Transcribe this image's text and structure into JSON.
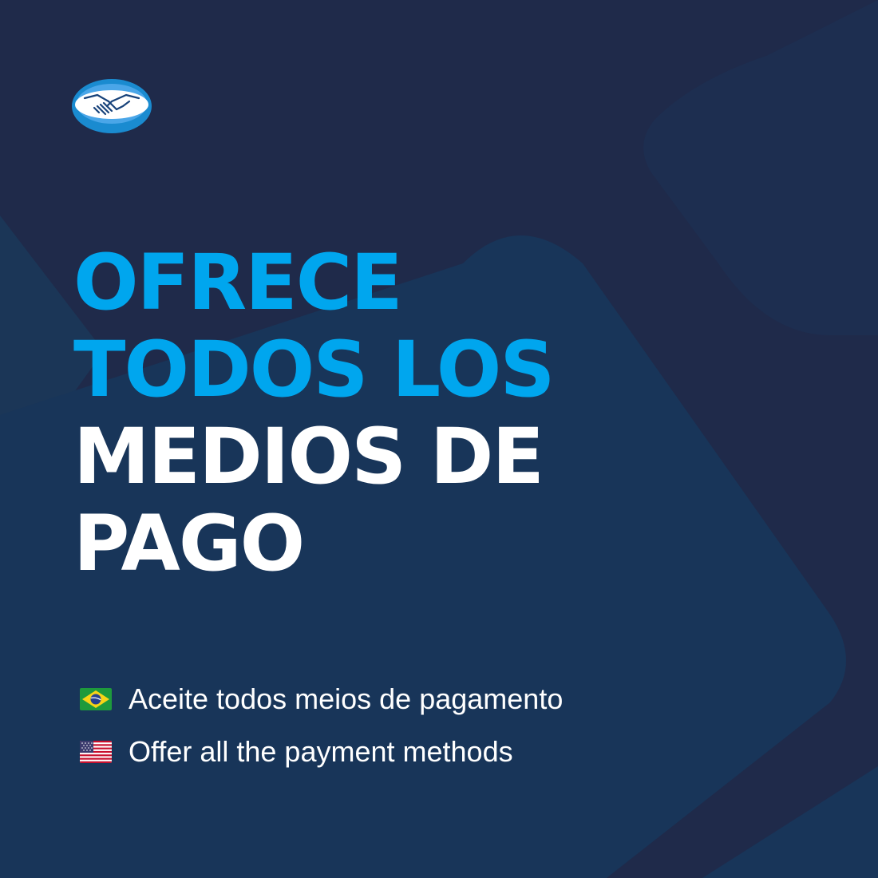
{
  "background": {
    "base_color": "#1f2a4a",
    "shape_color": "#193658"
  },
  "logo": {
    "name": "mercado-pago-handshake-logo",
    "colors": {
      "ring": "#1a8bd0",
      "inner": "#4aa6e8",
      "hands": "#ffffff"
    }
  },
  "headline": {
    "lines": [
      {
        "text": "OFRECE",
        "color": "#00a6ee"
      },
      {
        "text": "TODOS LOS",
        "color": "#00a6ee"
      },
      {
        "text": "MEDIOS DE",
        "color": "#ffffff"
      },
      {
        "text": "PAGO",
        "color": "#ffffff"
      }
    ]
  },
  "translations": [
    {
      "flag_icon": "brazil-flag-icon",
      "text": "Aceite todos meios de pagamento"
    },
    {
      "flag_icon": "usa-flag-icon",
      "text": "Offer all the payment methods"
    }
  ]
}
